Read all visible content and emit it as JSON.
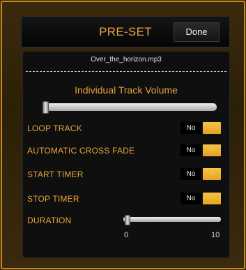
{
  "header": {
    "title": "PRE-SET",
    "done_label": "Done"
  },
  "panel": {
    "filename": "Over_the_horizon.mp3",
    "volume_title": "Individual Track Volume",
    "volume_level": 0.0
  },
  "settings": [
    {
      "label": "LOOP TRACK",
      "value": "No",
      "knob": "···"
    },
    {
      "label": "AUTOMATIC CROSS FADE",
      "value": "No",
      "knob": "···"
    },
    {
      "label": "START TIMER",
      "value": "No",
      "knob": "···"
    },
    {
      "label": "STOP TIMER",
      "value": "No",
      "knob": "···"
    }
  ],
  "duration": {
    "label": "DURATION",
    "min": "0",
    "max": "10",
    "value": 0
  },
  "colors": {
    "accent": "#e8a43a",
    "border": "#c9891f",
    "toggle_on": "#f0b830"
  }
}
